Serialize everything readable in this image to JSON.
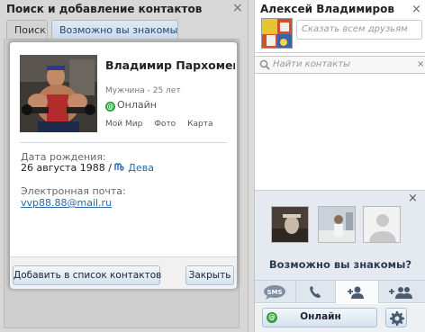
{
  "left_panel": {
    "title": "Поиск и добавление контактов",
    "close_glyph": "×",
    "tabs": [
      {
        "label": "Поиск"
      },
      {
        "label": "Возможно вы знакомы"
      }
    ]
  },
  "card": {
    "name": "Владимир Пархоменко",
    "meta": "Мужчина - 25 лет",
    "status": "Онлайн",
    "links": [
      "Мой Мир",
      "Фото",
      "Карта"
    ],
    "birthday_label": "Дата рождения:",
    "birthday_value": "26 августа 1988 / ",
    "zodiac": "Дева",
    "email_label": "Электронная почта:",
    "email_value": "vvp88.88@mail.ru",
    "add_button": "Добавить в список контактов",
    "close_button": "Закрыть"
  },
  "right_panel": {
    "user_name": "Алексей Владимиров",
    "close_glyph": "×",
    "say_placeholder": "Сказать всем друзьям",
    "search_placeholder": "Найти контакты",
    "search_clear_glyph": "×",
    "suggest_close_glyph": "×",
    "suggest_title": "Возможно вы знакомы?",
    "tabs": [
      {
        "icon": "sms-icon",
        "label": "SMS"
      },
      {
        "icon": "phone-icon"
      },
      {
        "icon": "add-contact-icon"
      },
      {
        "icon": "add-group-icon"
      }
    ],
    "status_button": "Онлайн",
    "status_glyph": "@"
  },
  "colors": {
    "accent_blue": "#2b6aa8",
    "online_green": "#2a9f3c",
    "panel_gray": "#d7d7d7"
  }
}
